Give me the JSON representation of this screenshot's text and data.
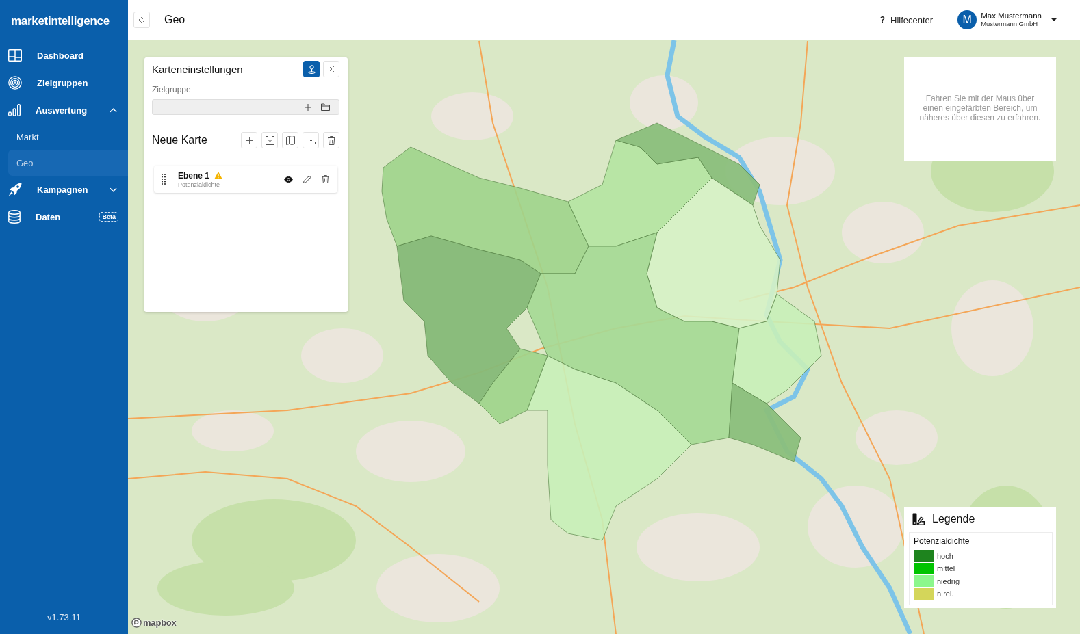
{
  "sidebar": {
    "logo": "marketintelligence",
    "items": [
      {
        "label": "Dashboard",
        "kind": "link",
        "selected": false
      },
      {
        "label": "Zielgruppen",
        "kind": "link",
        "selected": false
      },
      {
        "label": "Auswertung",
        "kind": "group",
        "selected": false,
        "expanded": true,
        "children": [
          {
            "label": "Markt",
            "selected": false
          },
          {
            "label": "Geo",
            "selected": true
          }
        ]
      },
      {
        "label": "Kampagnen",
        "kind": "group",
        "selected": false,
        "expanded": false
      },
      {
        "label": "Daten",
        "kind": "link",
        "selected": false,
        "badge": "Beta"
      }
    ],
    "version": "v1.73.11"
  },
  "top_bar": {
    "title": "Geo",
    "help": {
      "icon": "?",
      "label": "Hilfecenter"
    },
    "user": {
      "initial": "M",
      "name": "Max Mustermann",
      "company": "Mustermann GmbH"
    }
  },
  "map": {
    "attribution": "mapbox"
  },
  "map_settings": {
    "title": "Karteneinstellungen",
    "pinned": true,
    "target_group": {
      "label": "Zielgruppe"
    },
    "map_title": "Neue Karte",
    "layers": [
      {
        "name": "Ebene 1",
        "subtitle": "Potenzialdichte",
        "warning": true,
        "visible": true
      }
    ]
  },
  "hover_hint": "Fahren Sie mit der Maus über einen eingefärbten Bereich, um näheres über diesen zu erfahren.",
  "legend": {
    "title": "Legende",
    "subtitle": "Potenzialdichte",
    "items": [
      {
        "label": "hoch",
        "color": "#1e841e"
      },
      {
        "label": "mittel",
        "color": "#00c400"
      },
      {
        "label": "niedrig",
        "color": "#8cf78c"
      },
      {
        "label": "n.rel.",
        "color": "#d4d65a"
      }
    ]
  }
}
